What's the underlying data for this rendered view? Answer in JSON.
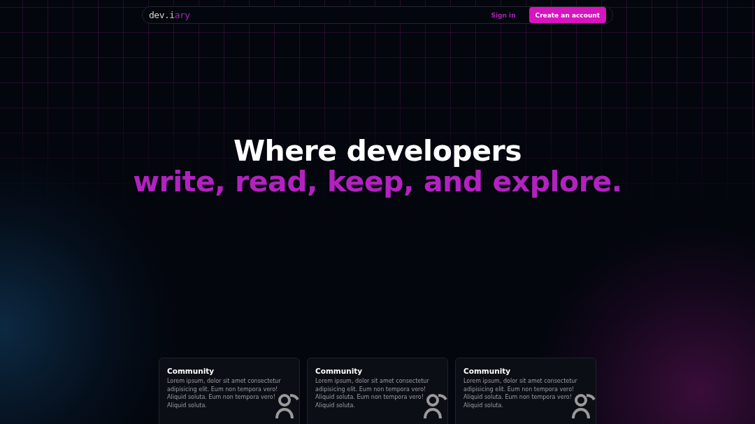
{
  "nav": {
    "logo": {
      "prefix": "dev.i",
      "accent": "ary"
    },
    "sign_in": "Sign in",
    "create_account": "Create an account"
  },
  "hero": {
    "line_1": "Where developers",
    "line_2": "write, read, keep, and explore."
  },
  "cards": [
    {
      "title": "Community",
      "text": "Lorem ipsum, dolor sit amet consectetur adipisicing elit. Eum non tempora vero! Aliquid soluta. Eum non tempora vero! Aliquid soluta."
    },
    {
      "title": "Community",
      "text": "Lorem ipsum, dolor sit amet consectetur adipisicing elit. Eum non tempora vero! Aliquid soluta. Eum non tempora vero! Aliquid soluta."
    },
    {
      "title": "Community",
      "text": "Lorem ipsum, dolor sit amet consectetur adipisicing elit. Eum non tempora vero! Aliquid soluta. Eum non tempora vero! Aliquid soluta."
    }
  ]
}
